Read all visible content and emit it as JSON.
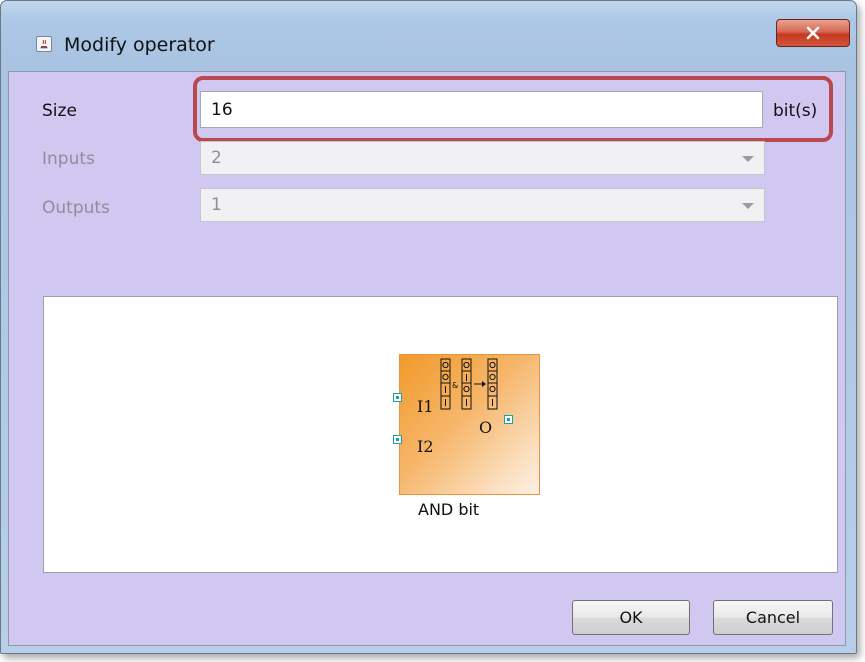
{
  "window": {
    "title": "Modify operator",
    "app_icon": "java-cup-icon",
    "close_icon": "close-x-icon"
  },
  "form": {
    "size_label": "Size",
    "size_value": "16",
    "size_unit": "bit(s)",
    "inputs_label": "Inputs",
    "inputs_value": "2",
    "outputs_label": "Outputs",
    "outputs_value": "1"
  },
  "preview": {
    "input1_label": "I1",
    "input2_label": "I2",
    "output_label": "O",
    "operator_name": "AND bit",
    "and_symbol": "&"
  },
  "buttons": {
    "ok_label": "OK",
    "cancel_label": "Cancel"
  },
  "colors": {
    "dialog_background": "#d1c8f2",
    "highlight_border": "#b9494f",
    "operator_fill": "#f19a2a"
  }
}
